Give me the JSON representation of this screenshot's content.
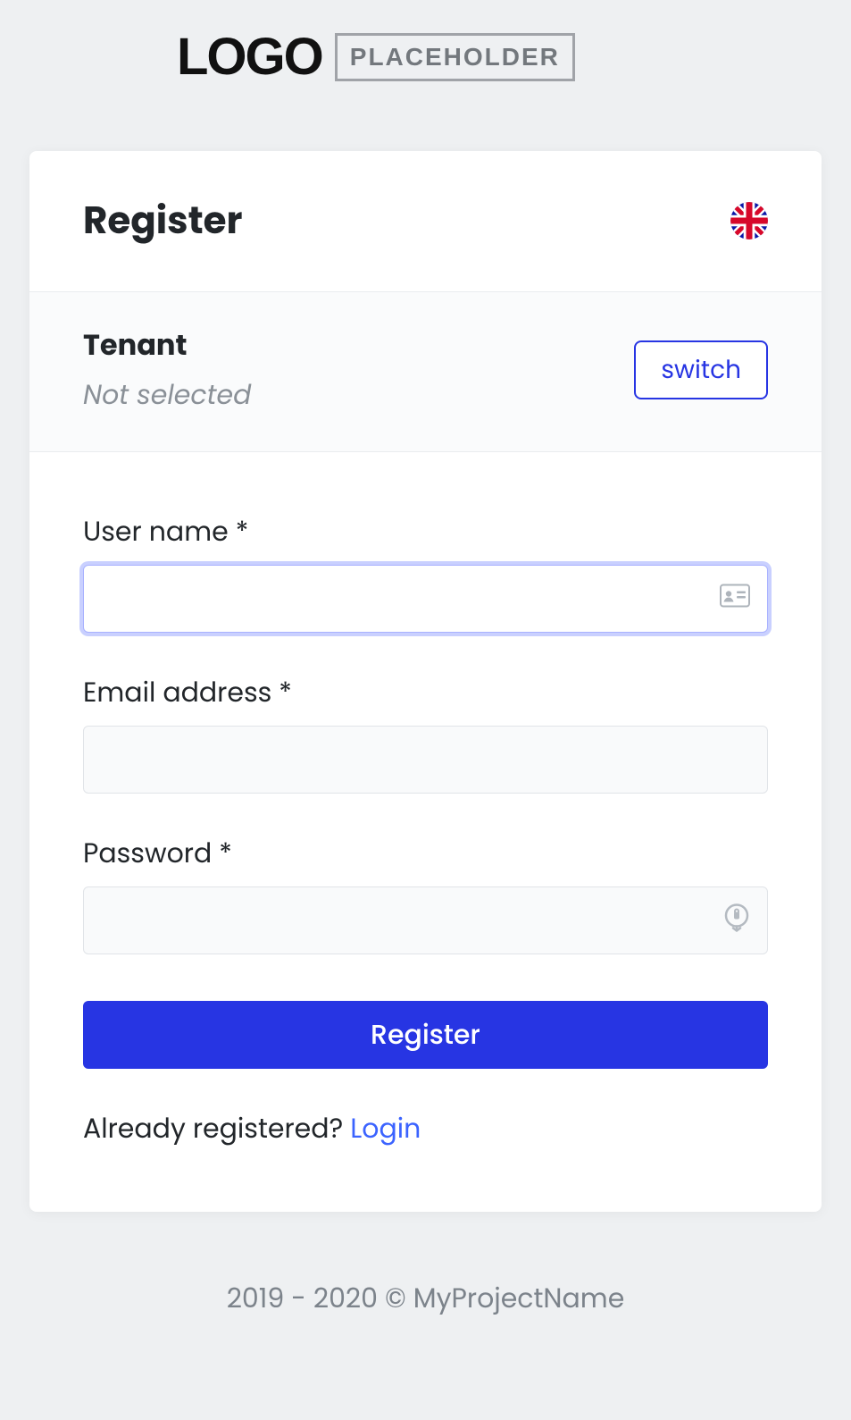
{
  "logo": {
    "word": "LOGO",
    "box": "PLACEHOLDER"
  },
  "card": {
    "title": "Register",
    "flag_name": "uk-flag"
  },
  "tenant": {
    "label": "Tenant",
    "value": "Not selected",
    "switch_label": "switch"
  },
  "form": {
    "username_label": "User name *",
    "username_value": "",
    "email_label": "Email address *",
    "email_value": "",
    "password_label": "Password *",
    "password_value": "",
    "submit_label": "Register"
  },
  "alt": {
    "prompt": "Already registered? ",
    "link": "Login"
  },
  "footer": "2019 - 2020 © MyProjectName"
}
